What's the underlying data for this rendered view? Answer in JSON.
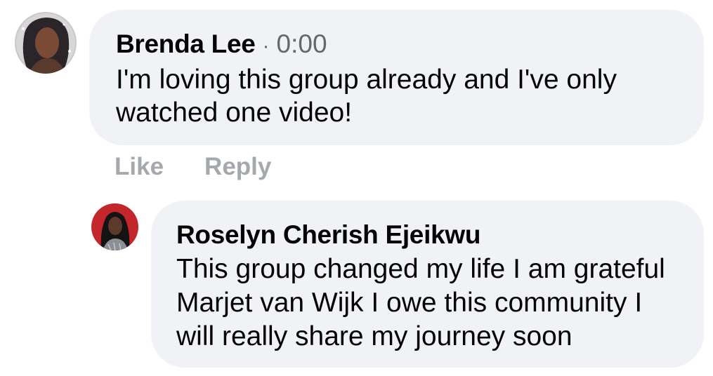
{
  "comment": {
    "author": "Brenda Lee",
    "separator": "·",
    "timestamp": "0:00",
    "text": "I'm loving this group already and I've only watched one video!",
    "actions": {
      "like": "Like",
      "reply": "Reply"
    },
    "avatar_icon": "user-avatar-photo"
  },
  "reply": {
    "author": "Roselyn Cherish Ejeikwu",
    "text": "This group changed my life I am grateful Marjet van Wijk I owe this community I will really share my journey soon",
    "avatar_icon": "user-avatar-photo"
  },
  "colors": {
    "bubble": "#f0f2f5",
    "text": "#050505",
    "meta": "#65676b",
    "action": "#a5a8ac"
  }
}
